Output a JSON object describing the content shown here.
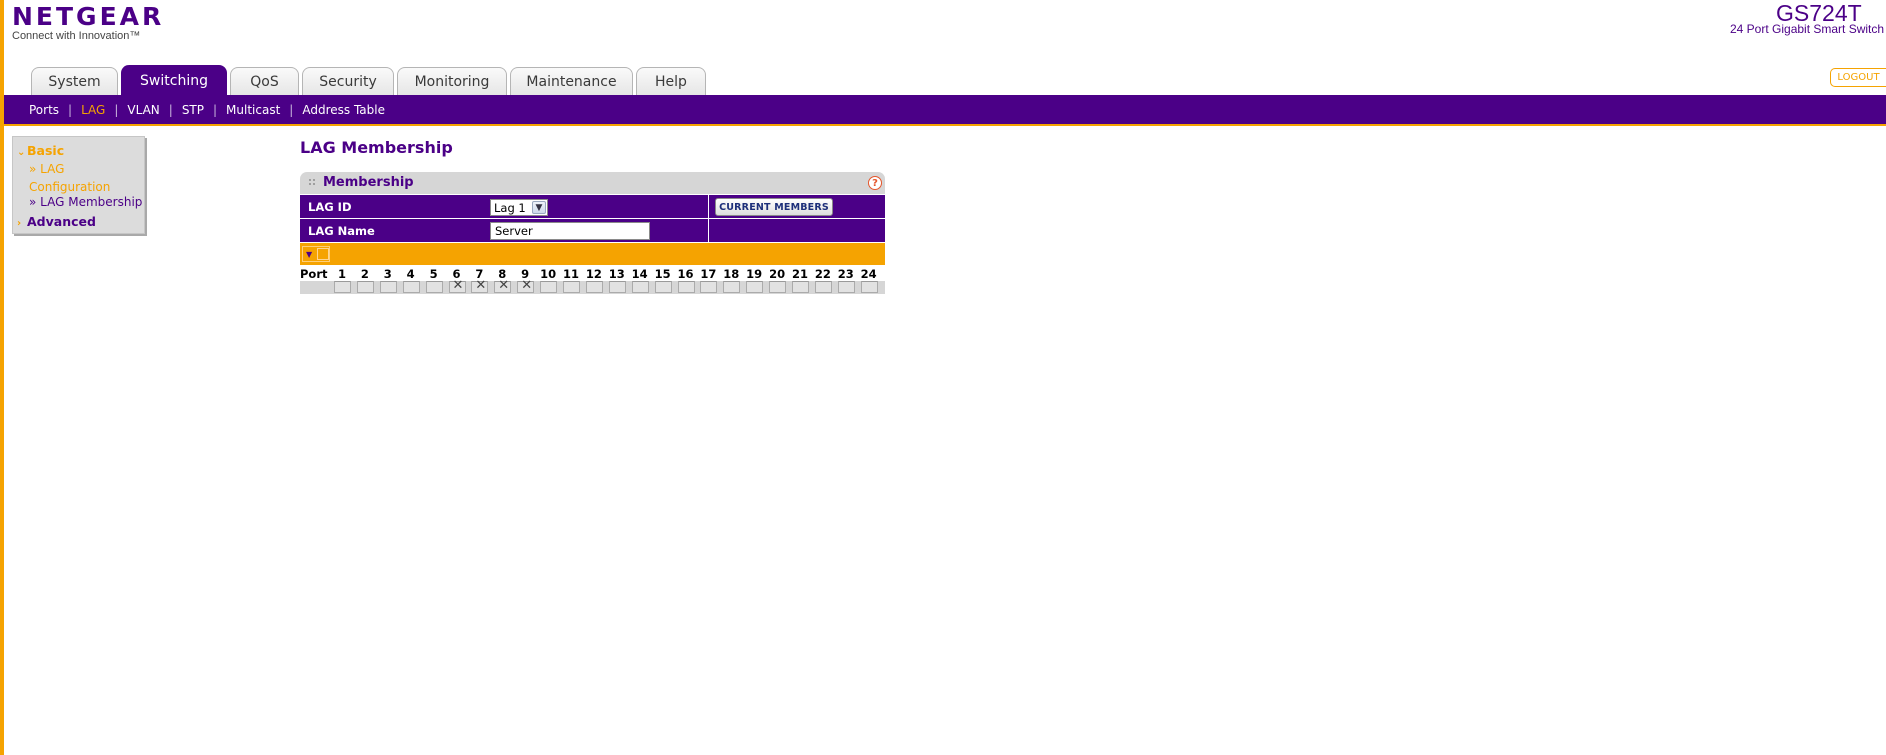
{
  "brand": {
    "logo": "NETGEAR",
    "tagline": "Connect with Innovation™"
  },
  "model": {
    "name": "GS724T",
    "description": "24 Port Gigabit Smart Switch"
  },
  "tabs": [
    "System",
    "Switching",
    "QoS",
    "Security",
    "Monitoring",
    "Maintenance",
    "Help"
  ],
  "active_tab": "Switching",
  "logout_label": "LOGOUT",
  "subnav": [
    "Ports",
    "LAG",
    "VLAN",
    "STP",
    "Multicast",
    "Address Table"
  ],
  "active_subnav": "LAG",
  "leftmenu": {
    "basic": "Basic",
    "lag_configuration": "» LAG Configuration",
    "lag_membership": "» LAG Membership",
    "advanced": "Advanced"
  },
  "page_title": "LAG Membership",
  "panel": {
    "title": "Membership",
    "help": "?",
    "lag_id_label": "LAG ID",
    "lag_id_value": "Lag 1",
    "current_members_button": "CURRENT MEMBERS",
    "lag_name_label": "LAG Name",
    "lag_name_value": "Server"
  },
  "ports": {
    "label": "Port",
    "numbers": [
      "1",
      "2",
      "3",
      "4",
      "5",
      "6",
      "7",
      "8",
      "9",
      "10",
      "11",
      "12",
      "13",
      "14",
      "15",
      "16",
      "17",
      "18",
      "19",
      "20",
      "21",
      "22",
      "23",
      "24"
    ],
    "selected": [
      6,
      7,
      8,
      9
    ]
  },
  "colors": {
    "brand_purple": "#4b0087",
    "accent_orange": "#f5a301"
  }
}
